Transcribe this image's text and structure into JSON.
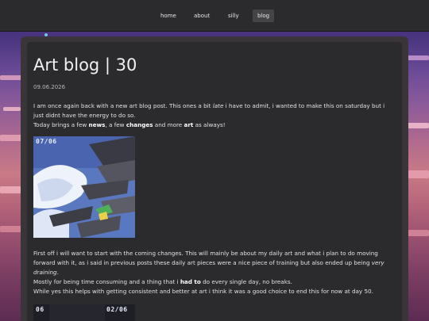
{
  "nav": {
    "items": [
      {
        "label": "home"
      },
      {
        "label": "about"
      },
      {
        "label": "silly"
      },
      {
        "label": "blog"
      }
    ],
    "active": "blog"
  },
  "post": {
    "title": "Art blog | 30",
    "date": "09.06.2026",
    "intro": {
      "s1": "I am once again back with a new art blog post. This ones a bit ",
      "late": "late",
      "s2": " i have to admit, i wanted to make this on saturday but i just didnt have the energy to do so.",
      "s3": "Today brings a few ",
      "news": "news",
      "s4": ", a few ",
      "changes": "changes",
      "s5": " and more ",
      "art": "art",
      "s6": " as always!"
    },
    "image1_label": "07/06",
    "body": {
      "s1": "First off i will want to start with the coming changes. This will mainly be about my daily art and what i plan to do moving forward with it, as i said in previous posts these daily art pieces were a nice piece of training but also ended up being ",
      "draining": "very draining",
      "s2": ".",
      "s3": "Mostly for being time consuming and a thing that i ",
      "had_to": "had to",
      "s4": " do every single day, no breaks.",
      "s5": "While yes this helps with getting consistent and better at art i think it was a good choice to end this for now at day 50."
    },
    "image2_label_left": "06",
    "image2_label_right": "02/06"
  },
  "colors": {
    "navbar": "#2b2b2d",
    "panel": "#2b2a2d",
    "text": "#e2e2e2"
  }
}
